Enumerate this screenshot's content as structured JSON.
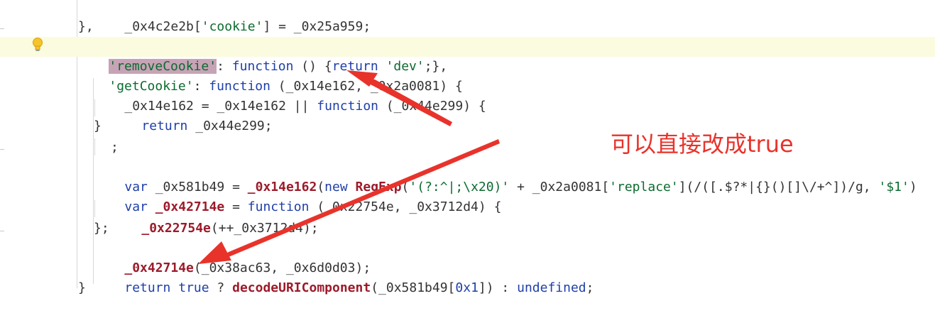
{
  "editor": {
    "lines": [
      {
        "id": "l1",
        "text": "  _0x4c2e2b['cookie'] = _0x25a959;"
      },
      {
        "id": "l2",
        "text": "},"
      },
      {
        "id": "l3",
        "text": "'removeCookie': function () {return 'dev';},",
        "selected": "'removeCookie'"
      },
      {
        "id": "l4",
        "text": "'getCookie': function (_0x14e162, _0x2a0081) {"
      },
      {
        "id": "l5",
        "text": "  _0x14e162 = _0x14e162 || function (_0x44e299) {"
      },
      {
        "id": "l6",
        "text": "    return _0x44e299;"
      },
      {
        "id": "l7",
        "text": "  }"
      },
      {
        "id": "l8",
        "text": "    ;"
      },
      {
        "id": "l9",
        "text": "  var _0x581b49 = _0x14e162(new RegExp('(?:^|;\\x20)' + _0x2a0081['replace'](/([.$?*|{}()[]\\/+^])/g, '$1')"
      },
      {
        "id": "l10",
        "text": "  var _0x42714e = function (_0x22754e, _0x3712d4) {"
      },
      {
        "id": "l11",
        "text": "    _0x22754e(++_0x3712d4);"
      },
      {
        "id": "l12",
        "text": "  };"
      },
      {
        "id": "l13",
        "text": "  _0x42714e(_0x38ac63, _0x6d0d03);"
      },
      {
        "id": "l14",
        "text": "  return true ? decodeURIComponent(_0x581b49[0x1]) : undefined;"
      }
    ],
    "tokens": {
      "l1": [
        "_0x4c2e2b[",
        "'cookie'",
        "] = _0x25a959;"
      ],
      "l2": [
        "},"
      ],
      "l3": [
        "'removeCookie'",
        ": ",
        "function",
        " () {",
        "return",
        " ",
        "'dev'",
        ";},"
      ],
      "l4": [
        "'getCookie'",
        ": ",
        "function",
        " (_0x14e162, _0x2a0081) {"
      ],
      "l5": [
        "_0x14e162 = _0x14e162 || ",
        "function",
        " (_0x44e299) {"
      ],
      "l6": [
        "return",
        " _0x44e299;"
      ],
      "l7": [
        "}"
      ],
      "l8": [
        ";"
      ],
      "l9": [
        "var",
        " _0x581b49 = ",
        "_0x14e162",
        "(",
        "new",
        " ",
        "RegExp",
        "(",
        "'(?:^|;\\x20)'",
        " + _0x2a0081[",
        "'replace'",
        "](/([.$?*|{}()[]\\/+^])/g, ",
        "'$1'",
        ")"
      ],
      "l10": [
        "var",
        " ",
        "_0x42714e",
        " = ",
        "function",
        " (_0x22754e, _0x3712d4) {"
      ],
      "l11": [
        "_0x22754e",
        "(++_0x3712d4);"
      ],
      "l12": [
        "};"
      ],
      "l13": [
        "_0x42714e",
        "(_0x38ac63, _0x6d0d03);"
      ],
      "l14": [
        "return",
        " ",
        "true",
        " ? ",
        "decodeURIComponent",
        "(_0x581b49[",
        "0x1",
        "]) : ",
        "undefined",
        ";"
      ]
    }
  },
  "annotation": {
    "text": "可以直接改成true",
    "color": "#e8332b"
  },
  "colors": {
    "keyword": "#1f3fa8",
    "string": "#0b6b2f",
    "function": "#9c1b2a",
    "highlight_line": "#fbfbe0",
    "selection": "#c7a3b6"
  },
  "icons": {
    "bulb": "lightbulb-icon"
  }
}
